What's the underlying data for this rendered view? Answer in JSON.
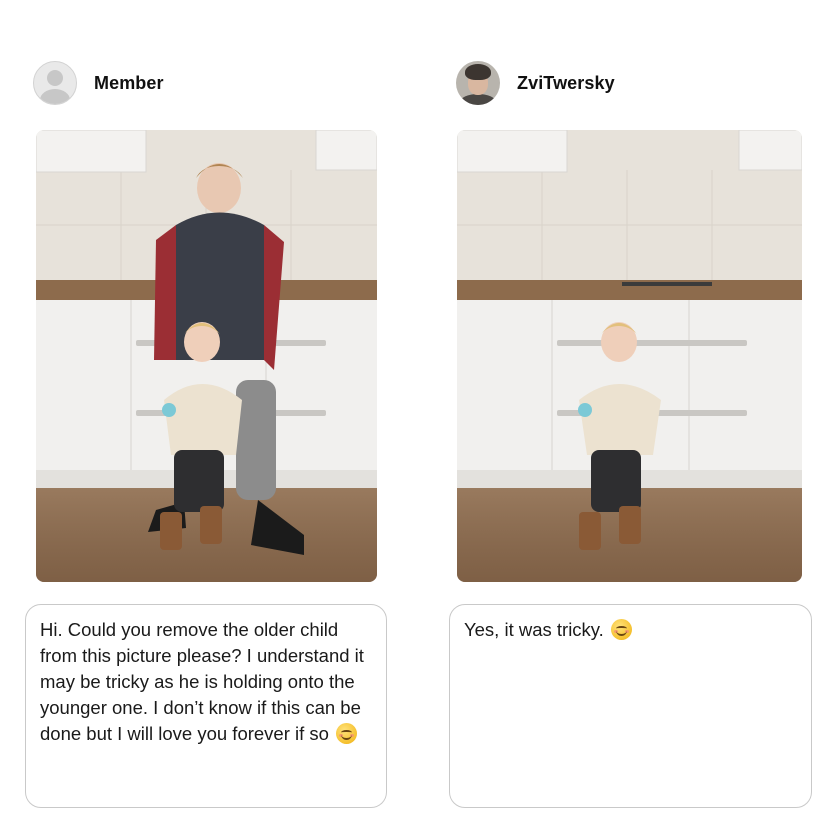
{
  "left_panel": {
    "username": "Member",
    "message": "Hi. Could you remove the older child from this picture please? I understand it may be tricky as he is holding onto the younger one. I don’t know if this can be done but I will love you forever if so",
    "emoji_icon": "smiling-face-icon",
    "photo_description_icon": "original-photo"
  },
  "right_panel": {
    "username": "ZviTwersky",
    "message": "Yes, it was tricky.",
    "emoji_icon": "smiling-face-icon",
    "photo_description_icon": "edited-photo"
  },
  "colors": {
    "text": "#1a1a1a",
    "bubble_border": "#c9c9c9",
    "floor": "#8a6a4e",
    "counter": "#8b6a4d",
    "wall": "#e6e1d9",
    "cabinet": "#f2f1ef"
  }
}
